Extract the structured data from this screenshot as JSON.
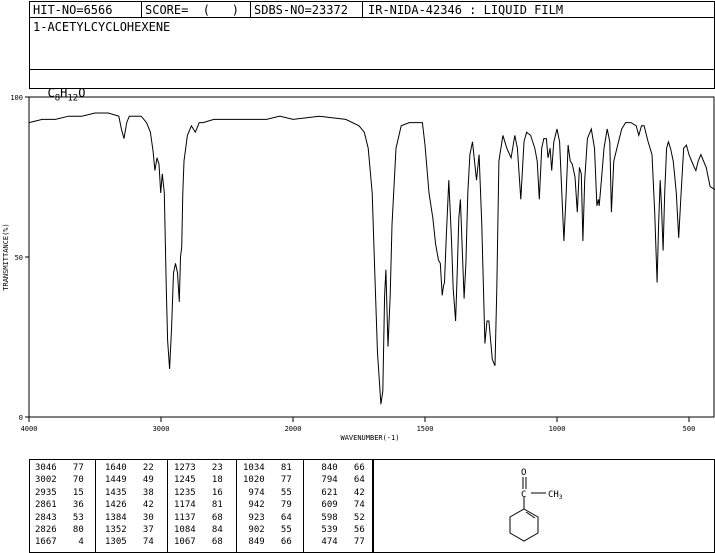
{
  "header": {
    "hit_no": "HIT-NO=6566",
    "score": "SCORE=  (   )",
    "sdbs_no": "SDBS-NO=23372",
    "ir_nida": "IR-NIDA-42346 : LIQUID FILM",
    "compound_name": "1-ACETYLCYCLOHEXENE",
    "formula_main": "C",
    "formula_c_sub": "8",
    "formula_h": "H",
    "formula_h_sub": "12",
    "formula_o": "O"
  },
  "chart_data": {
    "type": "line",
    "xlabel": "WAVENUMBER(-1)",
    "ylabel": "TRANSMITTANCE(%)",
    "xlim": [
      4000,
      400
    ],
    "ylim": [
      0,
      100
    ],
    "x_ticks": [
      "4000",
      "3000",
      "2000",
      "1500",
      "1000",
      "500"
    ],
    "y_ticks": [
      "100",
      "50",
      "0"
    ],
    "series": [
      {
        "points": [
          [
            4000,
            92
          ],
          [
            3900,
            93
          ],
          [
            3800,
            93
          ],
          [
            3700,
            94
          ],
          [
            3600,
            94
          ],
          [
            3500,
            95
          ],
          [
            3400,
            95
          ],
          [
            3320,
            94
          ],
          [
            3300,
            90
          ],
          [
            3280,
            87
          ],
          [
            3260,
            92
          ],
          [
            3240,
            94
          ],
          [
            3200,
            94
          ],
          [
            3150,
            94
          ],
          [
            3110,
            92
          ],
          [
            3080,
            89
          ],
          [
            3060,
            83
          ],
          [
            3046,
            77
          ],
          [
            3030,
            81
          ],
          [
            3015,
            79
          ],
          [
            3002,
            70
          ],
          [
            2990,
            76
          ],
          [
            2975,
            70
          ],
          [
            2960,
            40
          ],
          [
            2950,
            24
          ],
          [
            2935,
            15
          ],
          [
            2920,
            28
          ],
          [
            2905,
            45
          ],
          [
            2890,
            48
          ],
          [
            2875,
            45
          ],
          [
            2861,
            36
          ],
          [
            2852,
            50
          ],
          [
            2843,
            53
          ],
          [
            2835,
            70
          ],
          [
            2826,
            80
          ],
          [
            2800,
            88
          ],
          [
            2770,
            91
          ],
          [
            2740,
            89
          ],
          [
            2710,
            92
          ],
          [
            2680,
            92
          ],
          [
            2600,
            93
          ],
          [
            2500,
            93
          ],
          [
            2400,
            93
          ],
          [
            2300,
            93
          ],
          [
            2200,
            93
          ],
          [
            2100,
            94
          ],
          [
            2000,
            93
          ],
          [
            1900,
            94
          ],
          [
            1800,
            93
          ],
          [
            1750,
            91
          ],
          [
            1730,
            89
          ],
          [
            1715,
            84
          ],
          [
            1700,
            70
          ],
          [
            1690,
            45
          ],
          [
            1680,
            20
          ],
          [
            1667,
            4
          ],
          [
            1660,
            8
          ],
          [
            1653,
            38
          ],
          [
            1648,
            46
          ],
          [
            1640,
            22
          ],
          [
            1632,
            38
          ],
          [
            1625,
            60
          ],
          [
            1610,
            84
          ],
          [
            1590,
            91
          ],
          [
            1560,
            92
          ],
          [
            1530,
            92
          ],
          [
            1510,
            92
          ],
          [
            1500,
            85
          ],
          [
            1485,
            70
          ],
          [
            1470,
            62
          ],
          [
            1460,
            54
          ],
          [
            1449,
            49
          ],
          [
            1442,
            48
          ],
          [
            1435,
            38
          ],
          [
            1430,
            41
          ],
          [
            1426,
            42
          ],
          [
            1420,
            55
          ],
          [
            1410,
            74
          ],
          [
            1400,
            56
          ],
          [
            1393,
            40
          ],
          [
            1384,
            30
          ],
          [
            1378,
            45
          ],
          [
            1372,
            62
          ],
          [
            1366,
            68
          ],
          [
            1352,
            37
          ],
          [
            1345,
            48
          ],
          [
            1338,
            70
          ],
          [
            1330,
            82
          ],
          [
            1320,
            86
          ],
          [
            1305,
            74
          ],
          [
            1295,
            82
          ],
          [
            1285,
            60
          ],
          [
            1273,
            23
          ],
          [
            1265,
            30
          ],
          [
            1258,
            30
          ],
          [
            1245,
            18
          ],
          [
            1235,
            16
          ],
          [
            1228,
            40
          ],
          [
            1220,
            80
          ],
          [
            1205,
            88
          ],
          [
            1190,
            84
          ],
          [
            1174,
            81
          ],
          [
            1160,
            88
          ],
          [
            1150,
            84
          ],
          [
            1137,
            68
          ],
          [
            1125,
            86
          ],
          [
            1115,
            89
          ],
          [
            1100,
            88
          ],
          [
            1084,
            84
          ],
          [
            1075,
            80
          ],
          [
            1067,
            68
          ],
          [
            1058,
            84
          ],
          [
            1050,
            87
          ],
          [
            1040,
            87
          ],
          [
            1034,
            81
          ],
          [
            1026,
            84
          ],
          [
            1020,
            77
          ],
          [
            1012,
            86
          ],
          [
            1000,
            90
          ],
          [
            990,
            86
          ],
          [
            974,
            55
          ],
          [
            965,
            70
          ],
          [
            958,
            85
          ],
          [
            950,
            80
          ],
          [
            942,
            79
          ],
          [
            932,
            75
          ],
          [
            923,
            64
          ],
          [
            915,
            78
          ],
          [
            908,
            76
          ],
          [
            902,
            55
          ],
          [
            895,
            74
          ],
          [
            885,
            87
          ],
          [
            870,
            90
          ],
          [
            858,
            84
          ],
          [
            849,
            66
          ],
          [
            843,
            68
          ],
          [
            840,
            66
          ],
          [
            832,
            74
          ],
          [
            822,
            84
          ],
          [
            810,
            90
          ],
          [
            800,
            86
          ],
          [
            794,
            64
          ],
          [
            785,
            80
          ],
          [
            770,
            85
          ],
          [
            755,
            90
          ],
          [
            740,
            92
          ],
          [
            720,
            92
          ],
          [
            700,
            91
          ],
          [
            690,
            88
          ],
          [
            680,
            91
          ],
          [
            670,
            91
          ],
          [
            655,
            86
          ],
          [
            640,
            82
          ],
          [
            630,
            64
          ],
          [
            621,
            42
          ],
          [
            615,
            60
          ],
          [
            609,
            74
          ],
          [
            604,
            66
          ],
          [
            598,
            52
          ],
          [
            592,
            70
          ],
          [
            585,
            84
          ],
          [
            578,
            86
          ],
          [
            570,
            84
          ],
          [
            560,
            80
          ],
          [
            555,
            76
          ],
          [
            548,
            70
          ],
          [
            539,
            56
          ],
          [
            530,
            70
          ],
          [
            520,
            84
          ],
          [
            510,
            85
          ],
          [
            500,
            82
          ],
          [
            490,
            80
          ],
          [
            480,
            78
          ],
          [
            474,
            77
          ],
          [
            465,
            80
          ],
          [
            455,
            82
          ],
          [
            445,
            80
          ],
          [
            435,
            78
          ],
          [
            420,
            72
          ],
          [
            400,
            71
          ]
        ]
      }
    ],
    "grid": false
  },
  "peak_table": [
    [
      [
        "3046",
        "77"
      ],
      [
        "3002",
        "70"
      ],
      [
        "2935",
        "15"
      ],
      [
        "2861",
        "36"
      ],
      [
        "2843",
        "53"
      ],
      [
        "2826",
        "80"
      ],
      [
        "1667",
        "4"
      ]
    ],
    [
      [
        "1640",
        "22"
      ],
      [
        "1449",
        "49"
      ],
      [
        "1435",
        "38"
      ],
      [
        "1426",
        "42"
      ],
      [
        "1384",
        "30"
      ],
      [
        "1352",
        "37"
      ],
      [
        "1305",
        "74"
      ]
    ],
    [
      [
        "1273",
        "23"
      ],
      [
        "1245",
        "18"
      ],
      [
        "1235",
        "16"
      ],
      [
        "1174",
        "81"
      ],
      [
        "1137",
        "68"
      ],
      [
        "1084",
        "84"
      ],
      [
        "1067",
        "68"
      ]
    ],
    [
      [
        "1034",
        "81"
      ],
      [
        "1020",
        "77"
      ],
      [
        "974",
        "55"
      ],
      [
        "942",
        "79"
      ],
      [
        "923",
        "64"
      ],
      [
        "902",
        "55"
      ],
      [
        "849",
        "66"
      ]
    ],
    [
      [
        "840",
        "66"
      ],
      [
        "794",
        "64"
      ],
      [
        "621",
        "42"
      ],
      [
        "609",
        "74"
      ],
      [
        "598",
        "52"
      ],
      [
        "539",
        "56"
      ],
      [
        "474",
        "77"
      ]
    ]
  ],
  "structure": {
    "oxygen": "O",
    "carbon": "C",
    "methyl": "CH",
    "methyl_sub": "3"
  }
}
